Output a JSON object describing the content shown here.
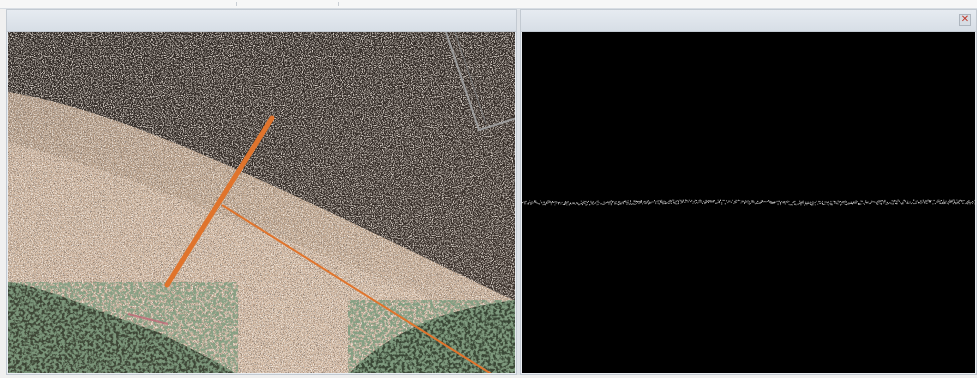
{
  "window": {
    "panes": [
      {
        "id": "plan-view",
        "header_title": ""
      },
      {
        "id": "profile-view",
        "header_title": ""
      }
    ]
  },
  "controls": {
    "close_glyph": "✕",
    "close_icon": "close-icon"
  },
  "colors": {
    "section_line": "#e0742c",
    "point_cloud_ground": "#c9ad95",
    "point_cloud_dark": "#1e1a17",
    "vegetation": "#3d5a3a",
    "profile_points": "#cfcfcf",
    "profile_background": "#000000",
    "header_background": "#dde3ea"
  }
}
